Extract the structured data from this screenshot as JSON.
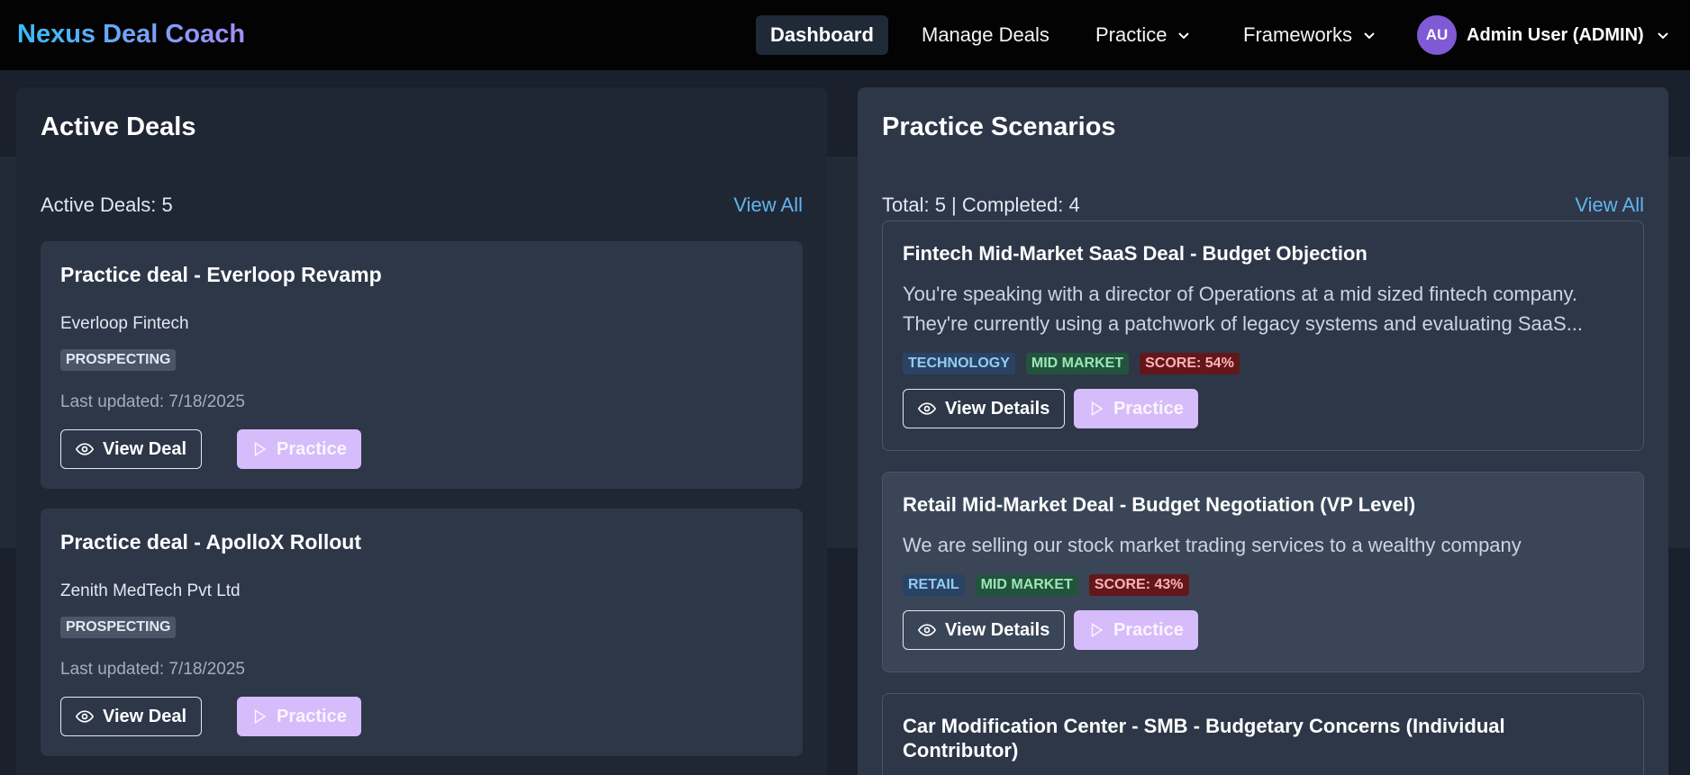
{
  "nav": {
    "brand": "Nexus Deal Coach",
    "items": [
      {
        "label": "Dashboard"
      },
      {
        "label": "Manage Deals"
      },
      {
        "label": "Practice"
      },
      {
        "label": "Frameworks"
      }
    ],
    "user": {
      "initials": "AU",
      "label": "Admin User (ADMIN)"
    }
  },
  "active_deals": {
    "title": "Active Deals",
    "meta": "Active Deals: 5",
    "view_all": "View All",
    "deals": [
      {
        "title": "Practice deal - Everloop Revamp",
        "company": "Everloop Fintech",
        "stage": "PROSPECTING",
        "updated": "Last updated: 7/18/2025",
        "view_label": "View Deal",
        "practice_label": "Practice"
      },
      {
        "title": "Practice deal - ApolloX Rollout",
        "company": "Zenith MedTech Pvt Ltd",
        "stage": "PROSPECTING",
        "updated": "Last updated: 7/18/2025",
        "view_label": "View Deal",
        "practice_label": "Practice"
      }
    ]
  },
  "practice": {
    "title": "Practice Scenarios",
    "meta": "Total: 5 | Completed: 4",
    "view_all": "View All",
    "scenarios": [
      {
        "title": "Fintech Mid-Market SaaS Deal - Budget Objection",
        "desc": "You're speaking with a director of Operations at a mid sized fintech company. They're currently using a patchwork of legacy systems and evaluating SaaS...",
        "tags": [
          "TECHNOLOGY",
          "MID MARKET",
          "SCORE: 54%"
        ],
        "view_label": "View Details",
        "practice_label": "Practice"
      },
      {
        "title": "Retail Mid-Market Deal - Budget Negotiation (VP Level)",
        "desc": "We are selling our stock market trading services to a wealthy company",
        "tags": [
          "RETAIL",
          "MID MARKET",
          "SCORE: 43%"
        ],
        "view_label": "View Details",
        "practice_label": "Practice"
      },
      {
        "title": "Car Modification Center - SMB - Budgetary Concerns (Individual Contributor)"
      }
    ]
  },
  "colors": {
    "accent": "#63b3ed",
    "practice_button": "#d6bcfa",
    "avatar": "#805ad5"
  }
}
